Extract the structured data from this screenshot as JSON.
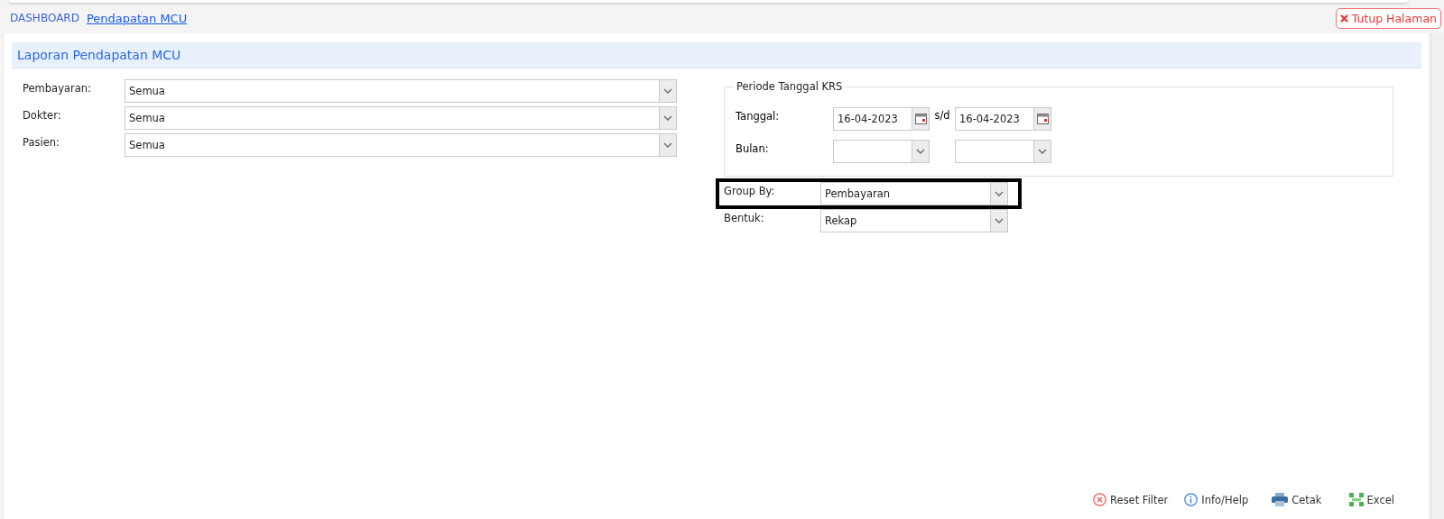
{
  "breadcrumb": [
    {
      "label": "DASHBOARD",
      "selected": false
    },
    {
      "label": "Pendapatan MCU",
      "selected": true
    }
  ],
  "close_button": {
    "label": "Tutup Halaman"
  },
  "panel": {
    "title": "Laporan Pendapatan MCU"
  },
  "filters": [
    {
      "label": "Pembayaran:",
      "value": "Semua"
    },
    {
      "label": "Dokter:",
      "value": "Semua"
    },
    {
      "label": "Pasien:",
      "value": "Semua"
    }
  ],
  "period": {
    "legend": "Periode Tanggal KRS",
    "date_label": "Tanggal:",
    "date_from": "16-04-2023",
    "separator": "s/d",
    "date_to": "16-04-2023",
    "month_label": "Bulan:"
  },
  "options": [
    {
      "label": "Group By:",
      "value": "Pembayaran",
      "highlighted": true
    },
    {
      "label": "Bentuk:",
      "value": "Rekap",
      "highlighted": false
    }
  ],
  "actions": [
    {
      "kind": "reset",
      "label": "Reset Filter"
    },
    {
      "kind": "info",
      "label": "Info/Help"
    },
    {
      "kind": "print",
      "label": "Cetak"
    },
    {
      "kind": "excel",
      "label": "Excel"
    }
  ]
}
